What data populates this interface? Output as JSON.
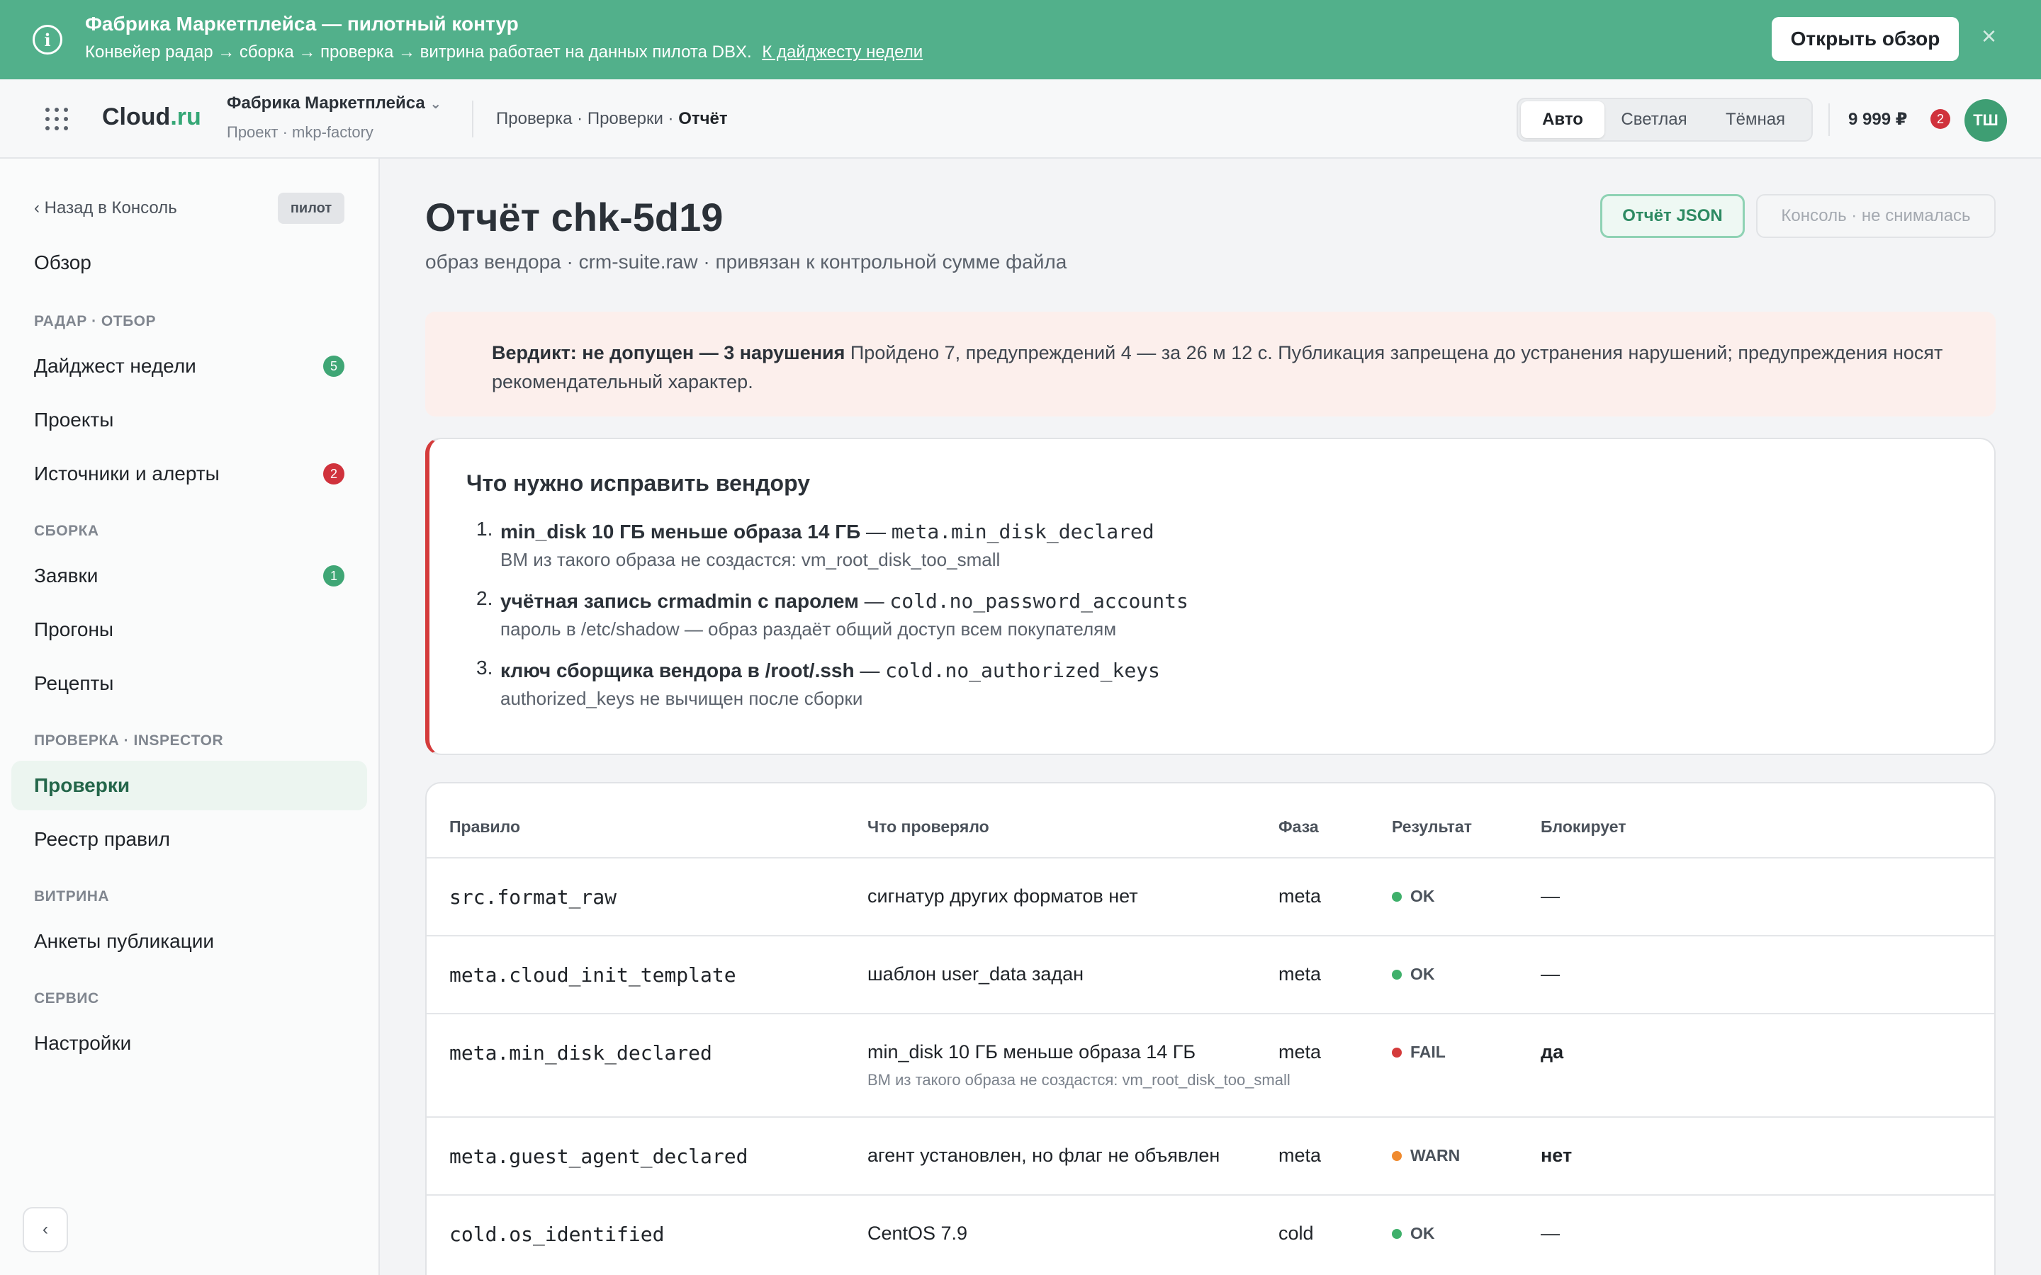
{
  "banner": {
    "title": "Фабрика Маркетплейса — пилотный контур",
    "text": "Конвейер радар → сборка → проверка → витрина работает на данных пилота DBX.",
    "link": "К дайджесту недели",
    "open_button": "Открыть обзор",
    "close": "×",
    "info": "i"
  },
  "header": {
    "logo_main": "Cloud",
    "logo_suffix": ".ru",
    "project_name": "Фабрика Маркетплейса",
    "project_sub": "Проект · mkp-factory",
    "breadcrumb": [
      "Проверка",
      "Проверки",
      "Отчёт"
    ],
    "breadcrumb_sep": " · ",
    "theme_options": [
      "Авто",
      "Светлая",
      "Тёмная"
    ],
    "theme_active": "Авто",
    "balance": "9 999 ₽",
    "notifications": "2",
    "avatar": "ТШ",
    "dropdown": "⌄"
  },
  "sidebar": {
    "back": "‹  Назад в Консоль",
    "pilot_badge": "пилот",
    "overview": "Обзор",
    "sections": [
      {
        "title": "РАДАР · ОТБОР",
        "items": [
          {
            "label": "Дайджест недели",
            "count": "5",
            "count_color": "#3fa675"
          },
          {
            "label": "Проекты"
          },
          {
            "label": "Источники и алерты",
            "count": "2",
            "count_color": "#d0323c"
          }
        ]
      },
      {
        "title": "СБОРКА",
        "items": [
          {
            "label": "Заявки",
            "count": "1",
            "count_color": "#3fa675"
          },
          {
            "label": "Прогоны"
          },
          {
            "label": "Рецепты"
          }
        ]
      },
      {
        "title": "ПРОВЕРКА · INSPECTOR",
        "items": [
          {
            "label": "Проверки",
            "active": true
          },
          {
            "label": "Реестр правил"
          }
        ]
      },
      {
        "title": "ВИТРИНА",
        "items": [
          {
            "label": "Анкеты публикации"
          }
        ]
      },
      {
        "title": "СЕРВИС",
        "items": [
          {
            "label": "Настройки"
          }
        ]
      }
    ],
    "collapse": "‹"
  },
  "page": {
    "title": "Отчёт chk-5d19",
    "subtitle": "образ вендора · crm-suite.raw · привязан к контрольной сумме файла",
    "btn_json": "Отчёт JSON",
    "btn_console": "Консоль · не снималась"
  },
  "verdict": {
    "title": "Вердикт: не допущен — 3 нарушения",
    "text": "Пройдено 7, предупреждений 4 — за 26 м 12 с. Публикация запрещена до устранения нарушений; предупреждения носят рекомендательный характер."
  },
  "fixes": {
    "title": "Что нужно исправить вендору",
    "items": [
      {
        "num": "1.",
        "bold": "min_disk 10 ГБ меньше образа 14 ГБ",
        "sep": " — ",
        "code": "meta.min_disk_declared",
        "detail": "ВМ из такого образа не создастся: vm_root_disk_too_small"
      },
      {
        "num": "2.",
        "bold": "учётная запись crmadmin с паролем",
        "sep": " — ",
        "code": "cold.no_password_accounts",
        "detail": "пароль в /etc/shadow — образ раздаёт общий доступ всем покупателям"
      },
      {
        "num": "3.",
        "bold": "ключ сборщика вендора в /root/.ssh",
        "sep": " — ",
        "code": "cold.no_authorized_keys",
        "detail": "authorized_keys не вычищен после сборки"
      }
    ]
  },
  "table": {
    "headers": {
      "rule": "Правило",
      "what": "Что проверяло",
      "phase": "Фаза",
      "result": "Результат",
      "blocks": "Блокирует"
    },
    "rows": [
      {
        "rule": "src.format_raw",
        "what": "сигнатур других форматов нет",
        "phase": "meta",
        "result": "OK",
        "result_color": "#3fb06b",
        "blocks": "—"
      },
      {
        "rule": "meta.cloud_init_template",
        "what": "шаблон user_data задан",
        "phase": "meta",
        "result": "OK",
        "result_color": "#3fb06b",
        "blocks": "—"
      },
      {
        "rule": "meta.min_disk_declared",
        "what": "min_disk 10 ГБ меньше образа 14 ГБ",
        "what_sub": "ВМ из такого образа не создастся: vm_root_disk_too_small",
        "phase": "meta",
        "result": "FAIL",
        "result_color": "#d43b3b",
        "blocks": "да"
      },
      {
        "rule": "meta.guest_agent_declared",
        "what": "агент установлен, но флаг не объявлен",
        "phase": "meta",
        "result": "WARN",
        "result_color": "#f08a2e",
        "blocks": "нет"
      },
      {
        "rule": "cold.os_identified",
        "what": "CentOS 7.9",
        "phase": "cold",
        "result": "OK",
        "result_color": "#3fb06b",
        "blocks": "—"
      }
    ]
  },
  "colors": {
    "accent": "#52b08b",
    "danger": "#d43b3b"
  }
}
